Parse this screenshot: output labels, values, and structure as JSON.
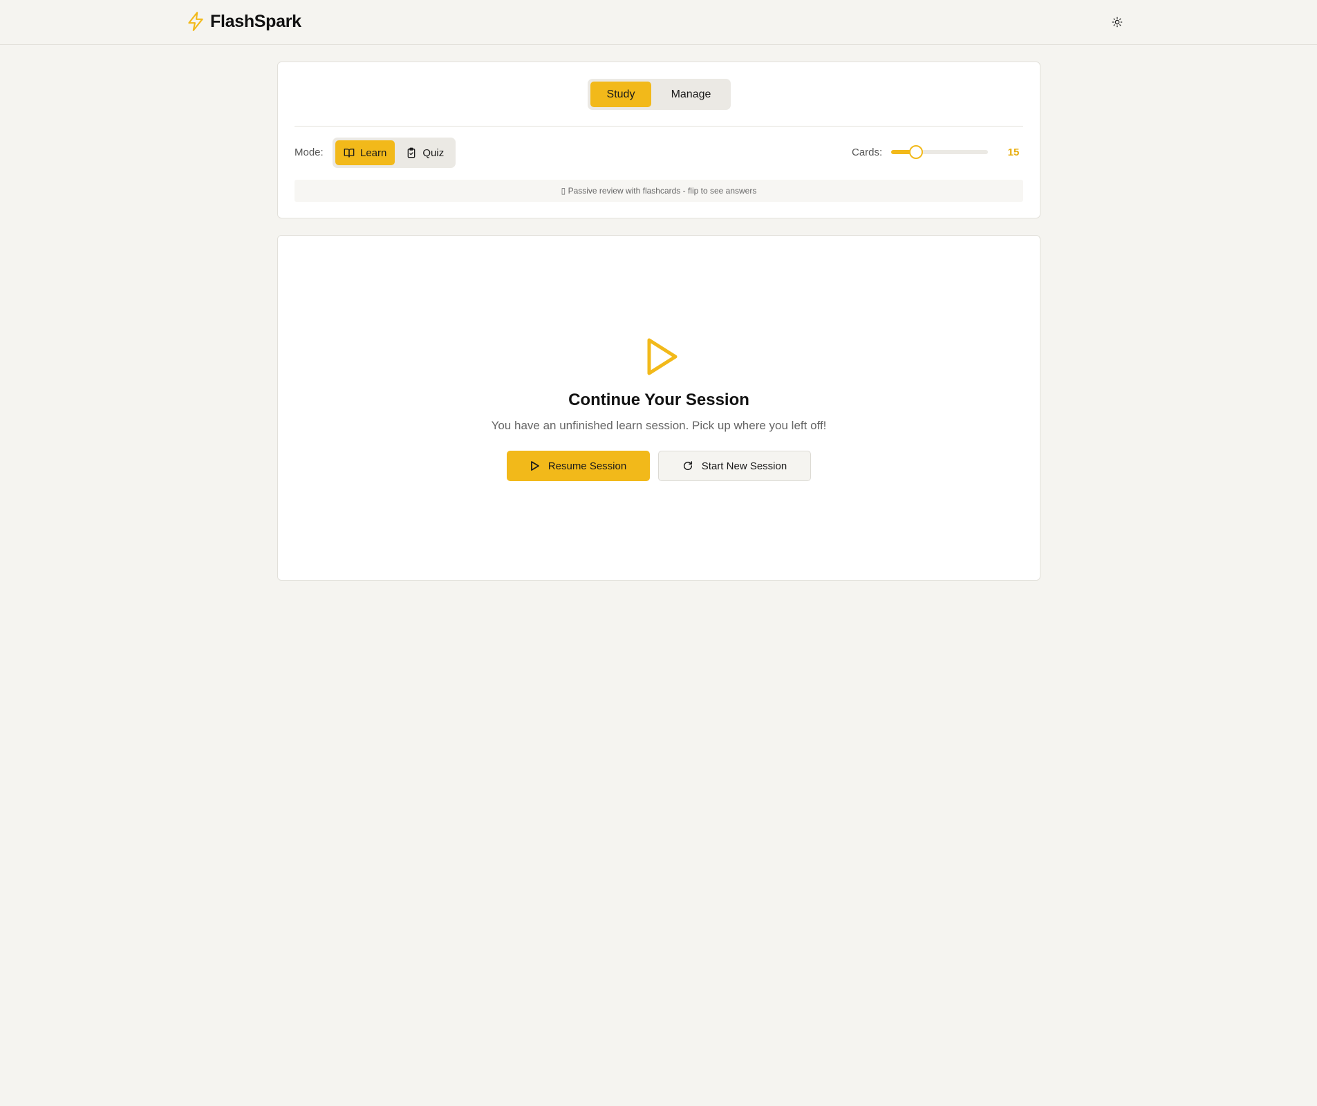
{
  "header": {
    "brand": "FlashSpark",
    "theme_icon": "sun-icon",
    "accent_color": "#f2b91a"
  },
  "tabs": [
    {
      "label": "Study",
      "active": true
    },
    {
      "label": "Manage",
      "active": false
    }
  ],
  "controls": {
    "mode_label": "Mode:",
    "modes": [
      {
        "label": "Learn",
        "icon": "book-open-icon",
        "active": true
      },
      {
        "label": "Quiz",
        "icon": "clipboard-check-icon",
        "active": false
      }
    ],
    "cards_label": "Cards:",
    "cards_value": "15",
    "cards_slider_fraction": 0.26,
    "hint": "▯ Passive review with flashcards - flip to see answers"
  },
  "session": {
    "icon": "play-icon",
    "title": "Continue Your Session",
    "text": "You have an unfinished learn session. Pick up where you left off!",
    "resume_label": "Resume Session",
    "resume_icon": "play-icon",
    "new_label": "Start New Session",
    "new_icon": "refresh-icon"
  }
}
